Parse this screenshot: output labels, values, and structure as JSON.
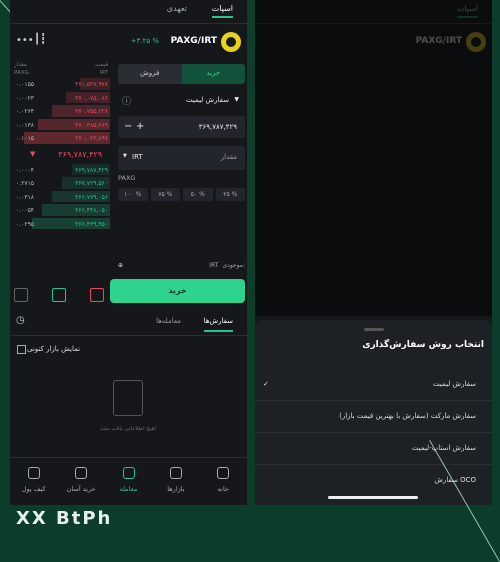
{
  "top_tabs": {
    "spot": "اسپات",
    "futures": "تعهدی"
  },
  "market": {
    "pair": "PAXG/IRT",
    "change": "+۳.۲۵ %"
  },
  "orderbook": {
    "header_price": "قیمت",
    "header_price_unit": "IRT",
    "header_amount": "مقدار",
    "header_amount_unit": "PAXG",
    "asks": [
      {
        "price": "۳۷۱,۵۳۷,۹۷۸",
        "qty": "۰.۰۱۵۵"
      },
      {
        "price": "۳۷۰,۰۷۵,۰۸۶",
        "qty": "۰.۰۰۲۳"
      },
      {
        "price": "۳۷۰,۷۵۵,۲۲۸",
        "qty": "۰.۰۲۶۴"
      },
      {
        "price": "۳۷۰,۳۸۵,۲۸۹",
        "qty": "۰.۰۱۳۸"
      },
      {
        "price": "۳۷۰,۰۳۳,۸۹۷",
        "qty": "۰.۱۰۱۵"
      }
    ],
    "last_price": "۳۶۹,۷۸۷,۴۲۹",
    "bids": [
      {
        "price": "۳۶۹,۷۸۷,۴۲۹",
        "qty": "۰.۰۰۰۴"
      },
      {
        "price": "۳۶۷,۷۲۹,۵۶۰",
        "qty": "۰.۲۷۱۵"
      },
      {
        "price": "۳۶۶,۷۷۹,۰۵۶",
        "qty": "۰.۰۳۱۸"
      },
      {
        "price": "۳۶۶,۴۴۸,۰۵۰",
        "qty": "۰.۰۰۵۴"
      },
      {
        "price": "۳۶۶,۴۳۹,۹۵۰",
        "qty": "۰.۰۲۹۵"
      }
    ]
  },
  "form": {
    "buy": "خرید",
    "sell": "فروش",
    "order_type": "سفارش لیمیت",
    "price_value": "۳۶۹,۷۸۷,۴۲۹",
    "amount_label": "مقدار",
    "amount_unit": "IRT",
    "coin": "PAXG",
    "percents": [
      "۱۰۰ %",
      "۷۵ %",
      "۵۰ %",
      "۲۵ %"
    ],
    "balance_label": "موجودی:",
    "balance_unit": "IRT",
    "buy_button": "خرید"
  },
  "orders": {
    "tab_orders": "سفارش‌ها",
    "tab_trades": "معامله‌ها",
    "show_current": "نمایش بازار کنونی",
    "empty": "هیچ اطلاعاتی یافت نشد!"
  },
  "nav": [
    "خانه",
    "بازارها",
    "معامله",
    "خرید آسان",
    "کیف پول"
  ],
  "sheet": {
    "title": "انتخاب روش سفارش‌گذاری",
    "options": [
      "سفارش لیمیت",
      "سفارش مارکت (سفارش با بهترین قیمت بازار)",
      "سفارش استاپ-لیمیت",
      "سفارش OCO"
    ],
    "check": "✓"
  },
  "brand": "XX BtPh"
}
